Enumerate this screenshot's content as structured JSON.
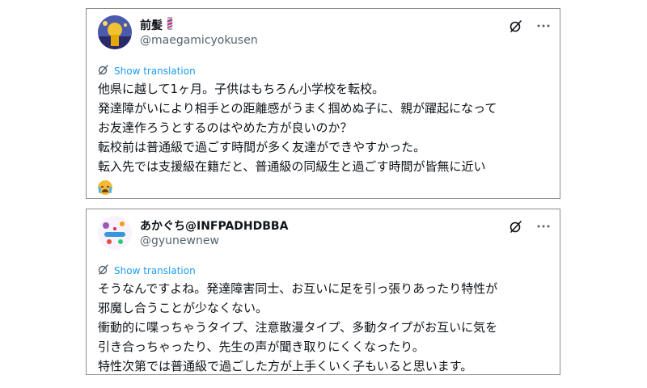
{
  "posts": [
    {
      "display_name": "前髪",
      "handle": "@maegamicyokusen",
      "show_translation": "Show translation",
      "lines": [
        "他県に越して1ヶ月。子供はもちろん小学校を転校。",
        "発達障がいにより相手との距離感がうまく掴めぬ子に、親が躍起になって",
        "お友達作ろうとするのはやめた方が良いのか？",
        "転校前は普通級で過ごす時間が多く友達ができやすかった。",
        "転入先では支援級在籍だと、普通級の同級生と過ごす時間が皆無に近い"
      ],
      "trailing_emoji": "crying-face-emoji"
    },
    {
      "display_name": "あかぐち@INFPADHDBBA",
      "handle": "@gyunewnew",
      "show_translation": "Show translation",
      "lines": [
        "そうなんですよね。発達障害同士、お互いに足を引っ張りあったり特性が",
        "邪魔し合うことが少なくない。",
        "衝動的に喋っちゃうタイプ、注意散漫タイプ、多動タイプがお互いに気を",
        "引き合っちゃったり、先生の声が聞き取りにくくなったり。",
        "特性次第では普通級で過ごした方が上手くいく子もいると思います。"
      ]
    }
  ],
  "colors": {
    "link": "#1d9bf0",
    "muted": "#536471",
    "text": "#0f1419"
  }
}
